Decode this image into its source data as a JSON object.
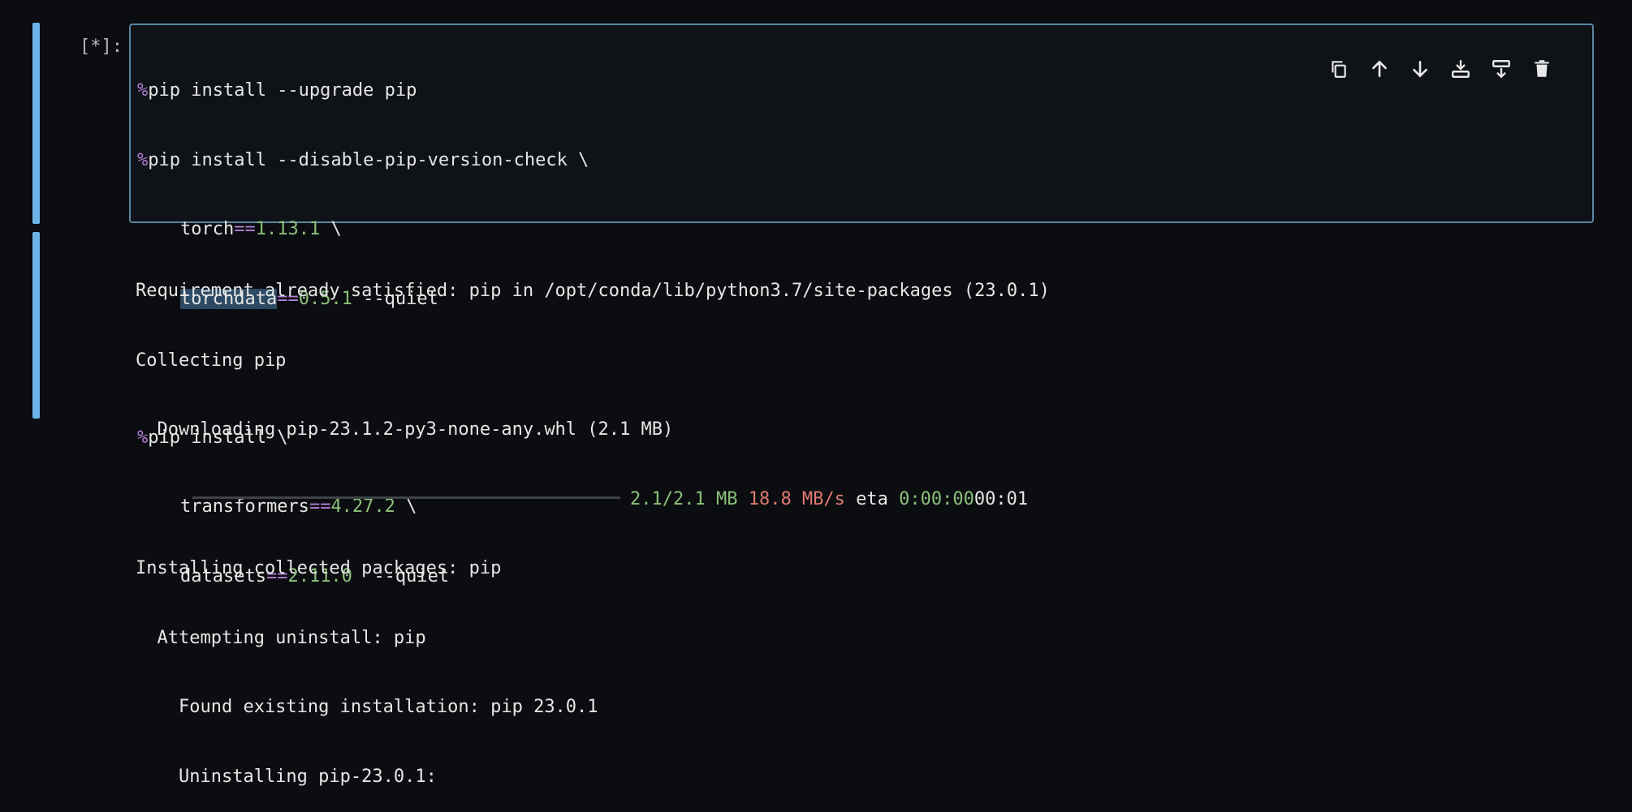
{
  "cell": {
    "prompt": "[*]:",
    "code_lines": [
      {
        "pct": "%",
        "a": "pip install --upgrade pip"
      },
      {
        "pct": "%",
        "a": "pip install --disable-pip-version-check \\"
      },
      {
        "indent": "    ",
        "name": "torch",
        "op": "==",
        "ver": "1.13.1",
        "tail": " \\"
      },
      {
        "indent": "    ",
        "name": "torchdata",
        "op": "==",
        "ver": "0.5.1",
        "tail": " --quiet"
      },
      {
        "blank": true
      },
      {
        "pct": "%",
        "a": "pip install \\"
      },
      {
        "indent": "    ",
        "name": "transformers",
        "op": "==",
        "ver": "4.27.2",
        "tail": " \\"
      },
      {
        "indent": "    ",
        "name": "datasets",
        "op": "==",
        "ver": "2.11.0",
        "tail": "  --quiet"
      }
    ],
    "toolbar": [
      {
        "name": "copy-icon"
      },
      {
        "name": "arrow-up-icon"
      },
      {
        "name": "arrow-down-icon"
      },
      {
        "name": "insert-above-icon"
      },
      {
        "name": "insert-below-icon"
      },
      {
        "name": "trash-icon"
      }
    ]
  },
  "output": {
    "line1": "Requirement already satisfied: pip in /opt/conda/lib/python3.7/site-packages (23.0.1)",
    "line2": "Collecting pip",
    "line3": "  Downloading pip-23.1.2-py3-none-any.whl (2.1 MB)",
    "progress": {
      "size": "2.1/2.1 MB",
      "speed": "18.8 MB/s",
      "eta_label": "eta",
      "eta_green": "0:00:00",
      "eta_rest": "00:01",
      "fraction": 1.0
    },
    "line5": "Installing collected packages: pip",
    "line6": "  Attempting uninstall: pip",
    "line7": "    Found existing installation: pip 23.0.1",
    "line8": "    Uninstalling pip-23.0.1:"
  },
  "colors": {
    "accent": "#6cb3e8",
    "magic": "#b67fd6",
    "number": "#8cc07a",
    "speed": "#e07b73"
  }
}
